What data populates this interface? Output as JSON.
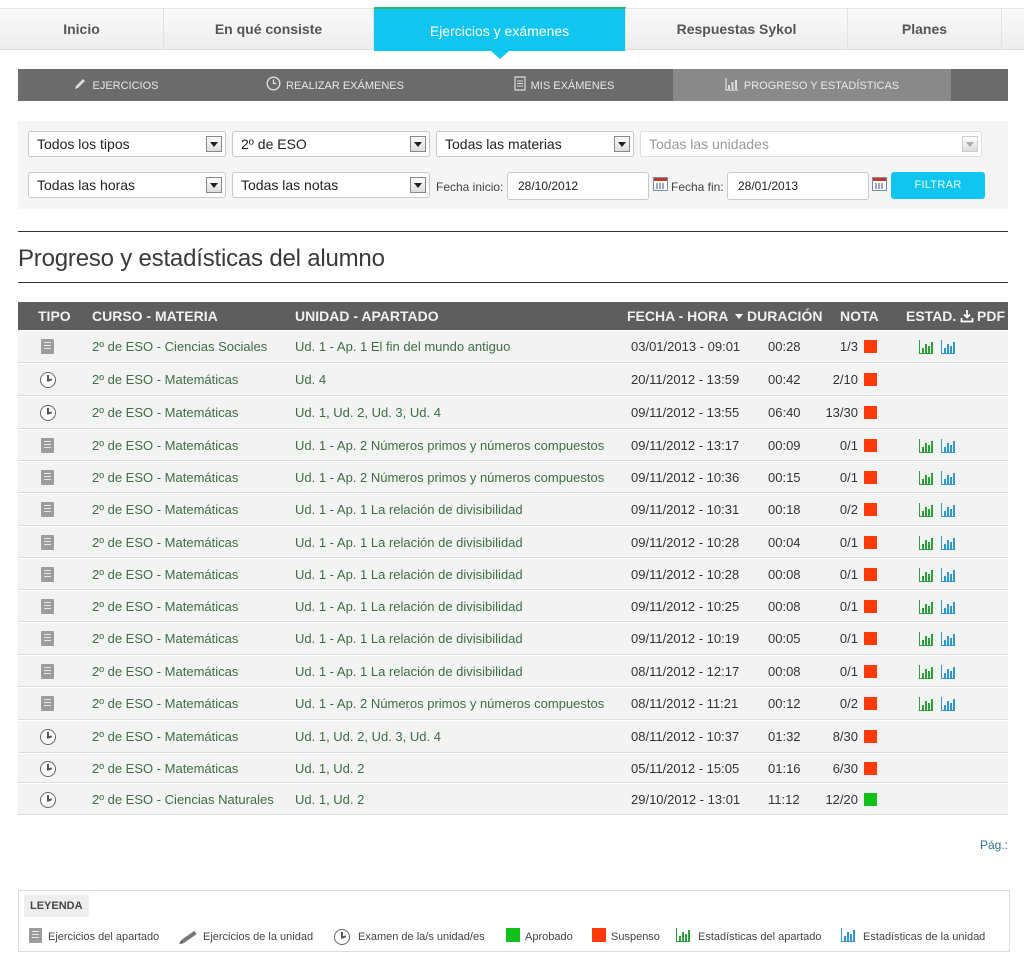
{
  "topnav": {
    "tabs": [
      {
        "label": "Inicio"
      },
      {
        "label": "En qué consiste"
      },
      {
        "label": "Ejercicios y exámenes"
      },
      {
        "label": "Respuestas Sykol"
      },
      {
        "label": "Planes"
      }
    ],
    "active_index": 2
  },
  "subnav": {
    "tabs": [
      {
        "label": "Ejercicios",
        "icon": "pencil-icon"
      },
      {
        "label": "Realizar exámenes",
        "icon": "clock-icon"
      },
      {
        "label": "Mis exámenes",
        "icon": "document-icon"
      },
      {
        "label": "Progreso y estadísticas",
        "icon": "chart-icon"
      }
    ],
    "active_index": 3
  },
  "filters": {
    "tipo": "Todos los tipos",
    "curso": "2º de ESO",
    "materia": "Todas las materias",
    "unidad": "Todas las unidades",
    "horas": "Todas las horas",
    "notas": "Todas las notas",
    "fecha_inicio_label": "Fecha inicio:",
    "fecha_inicio": "28/10/2012",
    "fecha_fin_label": "Fecha fin:",
    "fecha_fin": "28/01/2013",
    "filtrar_label": "FILTRAR"
  },
  "page_title": "Progreso y estadísticas del alumno",
  "table": {
    "headers": {
      "tipo": "TIPO",
      "curso": "CURSO - MATERIA",
      "unidad": "UNIDAD - APARTADO",
      "fecha": "FECHA - HORA",
      "duracion": "DURACIÓN",
      "nota": "NOTA",
      "estad": "ESTAD.",
      "pdf": "PDF"
    },
    "rows": [
      {
        "tipo": "apartado",
        "curso": "2º de ESO - Ciencias Sociales",
        "unidad": "Ud. 1 - Ap. 1 El fin del mundo antiguo",
        "fecha": "03/01/2013 - 09:01",
        "duracion": "00:28",
        "nota": "1/3",
        "estado": "suspenso",
        "stats": true
      },
      {
        "tipo": "examen",
        "curso": "2º de ESO - Matemáticas",
        "unidad": "Ud. 4",
        "fecha": "20/11/2012 - 13:59",
        "duracion": "00:42",
        "nota": "2/10",
        "estado": "suspenso",
        "stats": false
      },
      {
        "tipo": "examen",
        "curso": "2º de ESO - Matemáticas",
        "unidad": "Ud. 1, Ud. 2, Ud. 3, Ud. 4",
        "fecha": "09/11/2012 - 13:55",
        "duracion": "06:40",
        "nota": "13/30",
        "estado": "suspenso",
        "stats": false
      },
      {
        "tipo": "apartado",
        "curso": "2º de ESO - Matemáticas",
        "unidad": "Ud. 1 - Ap. 2 Números primos y números compuestos",
        "fecha": "09/11/2012 - 13:17",
        "duracion": "00:09",
        "nota": "0/1",
        "estado": "suspenso",
        "stats": true
      },
      {
        "tipo": "apartado",
        "curso": "2º de ESO - Matemáticas",
        "unidad": "Ud. 1 - Ap. 2 Números primos y números compuestos",
        "fecha": "09/11/2012 - 10:36",
        "duracion": "00:15",
        "nota": "0/1",
        "estado": "suspenso",
        "stats": true
      },
      {
        "tipo": "apartado",
        "curso": "2º de ESO - Matemáticas",
        "unidad": "Ud. 1 - Ap. 1 La relación de divisibilidad",
        "fecha": "09/11/2012 - 10:31",
        "duracion": "00:18",
        "nota": "0/2",
        "estado": "suspenso",
        "stats": true
      },
      {
        "tipo": "apartado",
        "curso": "2º de ESO - Matemáticas",
        "unidad": "Ud. 1 - Ap. 1 La relación de divisibilidad",
        "fecha": "09/11/2012 - 10:28",
        "duracion": "00:04",
        "nota": "0/1",
        "estado": "suspenso",
        "stats": true
      },
      {
        "tipo": "apartado",
        "curso": "2º de ESO - Matemáticas",
        "unidad": "Ud. 1 - Ap. 1 La relación de divisibilidad",
        "fecha": "09/11/2012 - 10:28",
        "duracion": "00:08",
        "nota": "0/1",
        "estado": "suspenso",
        "stats": true
      },
      {
        "tipo": "apartado",
        "curso": "2º de ESO - Matemáticas",
        "unidad": "Ud. 1 - Ap. 1 La relación de divisibilidad",
        "fecha": "09/11/2012 - 10:25",
        "duracion": "00:08",
        "nota": "0/1",
        "estado": "suspenso",
        "stats": true
      },
      {
        "tipo": "apartado",
        "curso": "2º de ESO - Matemáticas",
        "unidad": "Ud. 1 - Ap. 1 La relación de divisibilidad",
        "fecha": "09/11/2012 - 10:19",
        "duracion": "00:05",
        "nota": "0/1",
        "estado": "suspenso",
        "stats": true
      },
      {
        "tipo": "apartado",
        "curso": "2º de ESO - Matemáticas",
        "unidad": "Ud. 1 - Ap. 1 La relación de divisibilidad",
        "fecha": "08/11/2012 - 12:17",
        "duracion": "00:08",
        "nota": "0/1",
        "estado": "suspenso",
        "stats": true
      },
      {
        "tipo": "apartado",
        "curso": "2º de ESO - Matemáticas",
        "unidad": "Ud. 1 - Ap. 2 Números primos y números compuestos",
        "fecha": "08/11/2012 - 11:21",
        "duracion": "00:12",
        "nota": "0/2",
        "estado": "suspenso",
        "stats": true
      },
      {
        "tipo": "examen",
        "curso": "2º de ESO - Matemáticas",
        "unidad": "Ud. 1, Ud. 2, Ud. 3, Ud. 4",
        "fecha": "08/11/2012 - 10:37",
        "duracion": "01:32",
        "nota": "8/30",
        "estado": "suspenso",
        "stats": false
      },
      {
        "tipo": "examen",
        "curso": "2º de ESO - Matemáticas",
        "unidad": "Ud. 1, Ud. 2",
        "fecha": "05/11/2012 - 15:05",
        "duracion": "01:16",
        "nota": "6/30",
        "estado": "suspenso",
        "stats": false
      },
      {
        "tipo": "examen",
        "curso": "2º de ESO - Ciencias Naturales",
        "unidad": "Ud. 1, Ud. 2",
        "fecha": "29/10/2012 - 13:01",
        "duracion": "11:12",
        "nota": "12/20",
        "estado": "aprobado",
        "stats": false
      }
    ]
  },
  "pagination": {
    "label": "Pág.:"
  },
  "legend": {
    "title": "LEYENDA",
    "items": [
      {
        "icon": "document-icon",
        "label": "Ejercicios del apartado"
      },
      {
        "icon": "pencil-icon",
        "label": "Ejercicios de la unidad"
      },
      {
        "icon": "clock-icon",
        "label": "Examen de la/s unidad/es"
      },
      {
        "icon": "pass-square-icon",
        "label": "Aprobado"
      },
      {
        "icon": "fail-square-icon",
        "label": "Suspenso"
      },
      {
        "icon": "section-stats-icon",
        "label": "Estadísticas del apartado"
      },
      {
        "icon": "unit-stats-icon",
        "label": "Estadísticas de la unidad"
      }
    ]
  },
  "colors": {
    "accent": "#10c6f0",
    "aprobado": "#11c11a",
    "suspenso": "#ff3a0a",
    "header_bg": "#5e5e5e",
    "subnav_bg": "#6b6b6b"
  }
}
